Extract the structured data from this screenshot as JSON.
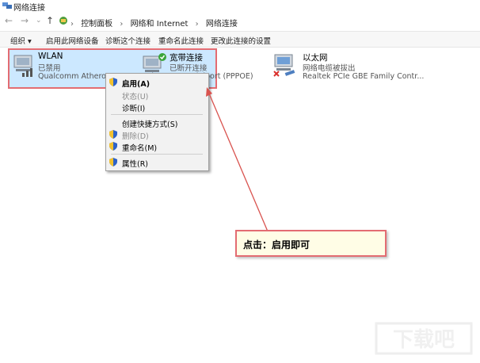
{
  "window": {
    "title": "网络连接"
  },
  "address": {
    "crumbs": [
      "控制面板",
      "网络和 Internet",
      "网络连接"
    ]
  },
  "toolbar": {
    "items": [
      "组织 ▾",
      "启用此网络设备",
      "诊断这个连接",
      "重命名此连接",
      "更改此连接的设置"
    ]
  },
  "connections": [
    {
      "name": "WLAN",
      "status": "已禁用",
      "device": "Qualcomm Atheros AR9000 Wi..."
    },
    {
      "name": "宽带连接",
      "status": "已断开连接",
      "device": "WAN Miniport (PPPOE)"
    },
    {
      "name": "以太网",
      "status": "网络电缆被拔出",
      "device": "Realtek PCIe GBE Family Contr..."
    }
  ],
  "context_menu": {
    "items": [
      {
        "label": "启用(A)",
        "disabled": false,
        "shield": true,
        "bold": true
      },
      {
        "label": "状态(U)",
        "disabled": true,
        "shield": false
      },
      {
        "label": "诊断(I)",
        "disabled": false,
        "shield": false
      },
      {
        "label": "创建快捷方式(S)",
        "disabled": false,
        "shield": false
      },
      {
        "label": "删除(D)",
        "disabled": true,
        "shield": true
      },
      {
        "label": "重命名(M)",
        "disabled": false,
        "shield": true
      },
      {
        "label": "属性(R)",
        "disabled": false,
        "shield": true
      }
    ]
  },
  "annotation": {
    "text": "点击：启用即可",
    "border_color": "#e36c72"
  },
  "watermark": {
    "text": "下载吧"
  },
  "colors": {
    "selection": "#cce8ff",
    "highlight_border": "#e36c72",
    "arrow": "#d9534f"
  }
}
